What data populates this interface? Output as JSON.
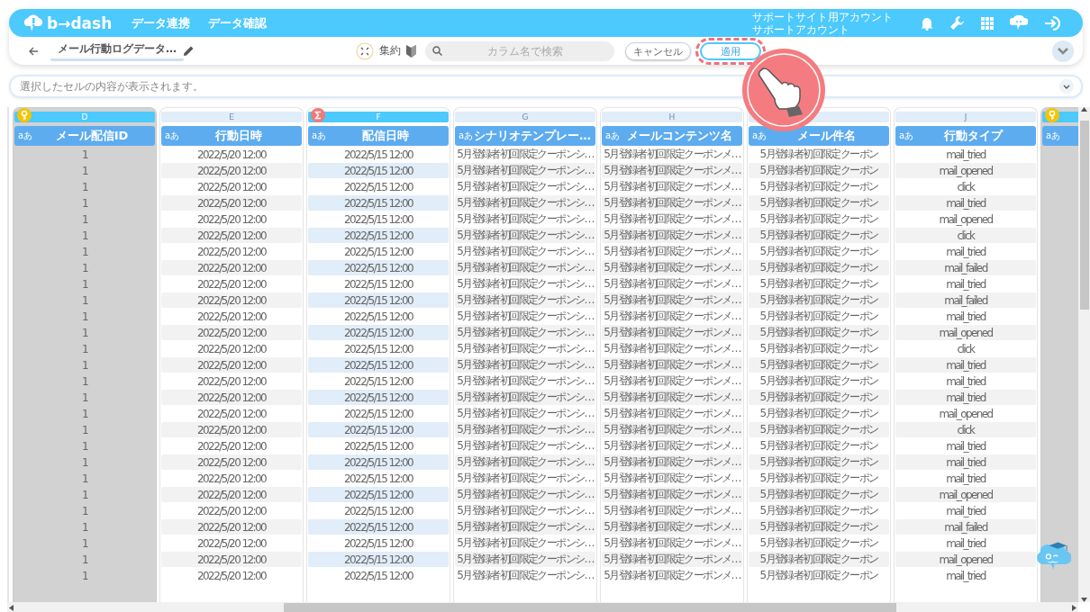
{
  "nav": {
    "logo": "b→dash",
    "links": [
      "データ連携",
      "データ確認"
    ],
    "account": [
      "サポートサイト用アカウント",
      "サポートアカウント"
    ]
  },
  "toolbar": {
    "title": "メール行動ログデータ…",
    "aggregate_label": "集約",
    "search": {
      "placeholder": "カラム名で検索"
    },
    "buttons": [
      {
        "label": "キャンセル",
        "kind": "cancel",
        "highlighted": false
      },
      {
        "label": "適用",
        "kind": "apply",
        "highlighted": true
      }
    ]
  },
  "cell_viewer": {
    "placeholder": "選択したセルの内容が表示されます。"
  },
  "columns": [
    {
      "letter": "D",
      "type": "aあ",
      "label": "メール配信ID",
      "kind": "key",
      "selected": true,
      "values": [
        "1",
        "1",
        "1",
        "1",
        "1",
        "1",
        "1",
        "1",
        "1",
        "1",
        "1",
        "1",
        "1",
        "1",
        "1",
        "1",
        "1",
        "1",
        "1",
        "1",
        "1",
        "1",
        "1",
        "1",
        "1",
        "1",
        "1"
      ]
    },
    {
      "letter": "E",
      "type": "aあ",
      "label": "行動日時",
      "kind": "plain",
      "selected": false,
      "values": [
        "2022/5/20 12:00",
        "2022/5/20 12:00",
        "2022/5/20 12:00",
        "2022/5/20 12:00",
        "2022/5/20 12:00",
        "2022/5/20 12:00",
        "2022/5/20 12:00",
        "2022/5/20 12:00",
        "2022/5/20 12:00",
        "2022/5/20 12:00",
        "2022/5/20 12:00",
        "2022/5/20 12:00",
        "2022/5/20 12:00",
        "2022/5/20 12:00",
        "2022/5/20 12:00",
        "2022/5/20 12:00",
        "2022/5/20 12:00",
        "2022/5/20 12:00",
        "2022/5/20 12:00",
        "2022/5/20 12:00",
        "2022/5/20 12:00",
        "2022/5/20 12:00",
        "2022/5/20 12:00",
        "2022/5/20 12:00",
        "2022/5/20 12:00",
        "2022/5/20 12:00",
        "2022/5/20 12:00"
      ]
    },
    {
      "letter": "F",
      "type": "aあ",
      "label": "配信日時",
      "kind": "sum",
      "selected": false,
      "values": [
        "2022/5/15 12:00",
        "2022/5/15 12:00",
        "2022/5/15 12:00",
        "2022/5/15 12:00",
        "2022/5/15 12:00",
        "2022/5/15 12:00",
        "2022/5/15 12:00",
        "2022/5/15 12:00",
        "2022/5/15 12:00",
        "2022/5/15 12:00",
        "2022/5/15 12:00",
        "2022/5/15 12:00",
        "2022/5/15 12:00",
        "2022/5/15 12:00",
        "2022/5/15 12:00",
        "2022/5/15 12:00",
        "2022/5/15 12:00",
        "2022/5/15 12:00",
        "2022/5/15 12:00",
        "2022/5/15 12:00",
        "2022/5/15 12:00",
        "2022/5/15 12:00",
        "2022/5/15 12:00",
        "2022/5/15 12:00",
        "2022/5/15 12:00",
        "2022/5/15 12:00",
        "2022/5/15 12:00"
      ]
    },
    {
      "letter": "G",
      "type": "aあ",
      "label": "シナリオテンプレー…",
      "kind": "plain",
      "selected": false,
      "values": [
        "5月登録者初回限定クーポンシ…",
        "5月登録者初回限定クーポンシ…",
        "5月登録者初回限定クーポンシ…",
        "5月登録者初回限定クーポンシ…",
        "5月登録者初回限定クーポンシ…",
        "5月登録者初回限定クーポンシ…",
        "5月登録者初回限定クーポンシ…",
        "5月登録者初回限定クーポンシ…",
        "5月登録者初回限定クーポンシ…",
        "5月登録者初回限定クーポンシ…",
        "5月登録者初回限定クーポンシ…",
        "5月登録者初回限定クーポンシ…",
        "5月登録者初回限定クーポンシ…",
        "5月登録者初回限定クーポンシ…",
        "5月登録者初回限定クーポンシ…",
        "5月登録者初回限定クーポンシ…",
        "5月登録者初回限定クーポンシ…",
        "5月登録者初回限定クーポンシ…",
        "5月登録者初回限定クーポンシ…",
        "5月登録者初回限定クーポンシ…",
        "5月登録者初回限定クーポンシ…",
        "5月登録者初回限定クーポンシ…",
        "5月登録者初回限定クーポンシ…",
        "5月登録者初回限定クーポンシ…",
        "5月登録者初回限定クーポンシ…",
        "5月登録者初回限定クーポンシ…",
        "5月登録者初回限定クーポンシ…"
      ]
    },
    {
      "letter": "H",
      "type": "aあ",
      "label": "メールコンテンツ名",
      "kind": "plain",
      "selected": false,
      "values": [
        "5月登録者初回限定クーポンメ…",
        "5月登録者初回限定クーポンメ…",
        "5月登録者初回限定クーポンメ…",
        "5月登録者初回限定クーポンメ…",
        "5月登録者初回限定クーポンメ…",
        "5月登録者初回限定クーポンメ…",
        "5月登録者初回限定クーポンメ…",
        "5月登録者初回限定クーポンメ…",
        "5月登録者初回限定クーポンメ…",
        "5月登録者初回限定クーポンメ…",
        "5月登録者初回限定クーポンメ…",
        "5月登録者初回限定クーポンメ…",
        "5月登録者初回限定クーポンメ…",
        "5月登録者初回限定クーポンメ…",
        "5月登録者初回限定クーポンメ…",
        "5月登録者初回限定クーポンメ…",
        "5月登録者初回限定クーポンメ…",
        "5月登録者初回限定クーポンメ…",
        "5月登録者初回限定クーポンメ…",
        "5月登録者初回限定クーポンメ…",
        "5月登録者初回限定クーポンメ…",
        "5月登録者初回限定クーポンメ…",
        "5月登録者初回限定クーポンメ…",
        "5月登録者初回限定クーポンメ…",
        "5月登録者初回限定クーポンメ…",
        "5月登録者初回限定クーポンメ…",
        "5月登録者初回限定クーポンメ…"
      ]
    },
    {
      "type": "aあ",
      "label": "メール件名",
      "kind": "plain",
      "selected": false,
      "values": [
        "5月登録者初回限定クーポン",
        "5月登録者初回限定クーポン",
        "5月登録者初回限定クーポン",
        "5月登録者初回限定クーポン",
        "5月登録者初回限定クーポン",
        "5月登録者初回限定クーポン",
        "5月登録者初回限定クーポン",
        "5月登録者初回限定クーポン",
        "5月登録者初回限定クーポン",
        "5月登録者初回限定クーポン",
        "5月登録者初回限定クーポン",
        "5月登録者初回限定クーポン",
        "5月登録者初回限定クーポン",
        "5月登録者初回限定クーポン",
        "5月登録者初回限定クーポン",
        "5月登録者初回限定クーポン",
        "5月登録者初回限定クーポン",
        "5月登録者初回限定クーポン",
        "5月登録者初回限定クーポン",
        "5月登録者初回限定クーポン",
        "5月登録者初回限定クーポン",
        "5月登録者初回限定クーポン",
        "5月登録者初回限定クーポン",
        "5月登録者初回限定クーポン",
        "5月登録者初回限定クーポン",
        "5月登録者初回限定クーポン",
        "5月登録者初回限定クーポン"
      ]
    },
    {
      "letter": "J",
      "type": "aあ",
      "label": "行動タイプ",
      "kind": "plain",
      "selected": false,
      "values": [
        "mail_tried",
        "mail_opened",
        "click",
        "mail_tried",
        "mail_opened",
        "click",
        "mail_tried",
        "mail_failed",
        "mail_tried",
        "mail_failed",
        "mail_tried",
        "mail_opened",
        "click",
        "mail_tried",
        "mail_tried",
        "mail_tried",
        "mail_opened",
        "click",
        "mail_tried",
        "mail_tried",
        "mail_tried",
        "mail_opened",
        "mail_tried",
        "mail_failed",
        "mail_tried",
        "mail_opened",
        "mail_tried"
      ]
    },
    {
      "type": "aあ",
      "kind": "key",
      "selected": true
    }
  ]
}
